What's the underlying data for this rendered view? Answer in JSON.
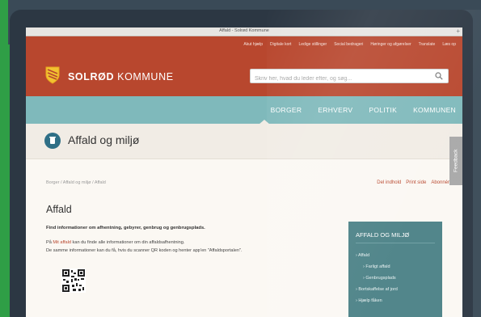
{
  "window": {
    "title": "Affald - Solrød Kommune",
    "plus_label": "+"
  },
  "header": {
    "top_links": [
      "Akut hjælp",
      "Digitale kort",
      "Ledige stillinger",
      "Social bedrageri",
      "Høringer og afgørelser",
      "Translate",
      "Læs op"
    ],
    "brand_bold": "SOLRØD",
    "brand_rest": " KOMMUNE",
    "search_placeholder": "Skriv her, hvad du leder efter, og søg..."
  },
  "nav": {
    "items": [
      "BORGER",
      "ERHVERV",
      "POLITIK",
      "KOMMUNEN"
    ]
  },
  "section": {
    "title": "Affald og miljø"
  },
  "feedback_label": "Feedback",
  "breadcrumb": "Borger /  Affald og miljø /  Affald",
  "tools": [
    "Del indhold",
    "Print side",
    "Abonnér"
  ],
  "content": {
    "heading": "Affald",
    "intro": "Find informationer om afhentning, gebyrer, genbrug og genbrugsplads.",
    "p1_prefix": "På ",
    "p1_link": "Mit affald",
    "p1_suffix": " kan du finde alle informationer om din affaldsafhentning.",
    "p2": "De samme informationer kan du få, hvis du scanner QR koden og henter app'en \"Affaldsportalen\"."
  },
  "sidebar": {
    "title": "AFFALD OG MILJØ",
    "items": [
      "› Affald",
      "› Farligt affald",
      "› Genbrugsplads",
      "› Bortskaffelse af jord",
      "› Hjælp fåken"
    ]
  },
  "colors": {
    "header": "#b8472e",
    "nav": "#7fb9bb",
    "sidebar": "#4c8287",
    "accent": "#b8472e"
  },
  "icons": {
    "logo": "shield-logo-icon",
    "search": "search-icon",
    "section": "trash-bin-icon",
    "qr": "qr-code-icon"
  }
}
